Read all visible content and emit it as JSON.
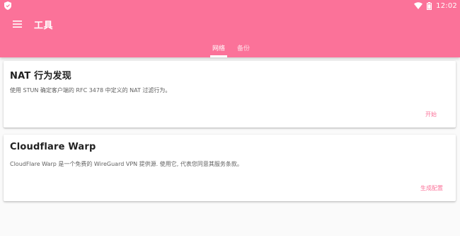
{
  "status_bar": {
    "time": "12:02",
    "icons": [
      "app-shield-icon",
      "wifi-icon",
      "battery-icon"
    ]
  },
  "toolbar": {
    "menu_icon": "menu-icon",
    "title": "工具"
  },
  "tabs": [
    {
      "label": "网络",
      "selected": true
    },
    {
      "label": "备份",
      "selected": false
    }
  ],
  "cards": [
    {
      "title": "NAT 行为发现",
      "description": "使用 STUN 确定客户端的 RFC 3478 中定义的 NAT 过滤行为。",
      "action": "开始"
    },
    {
      "title": "Cloudflare Warp",
      "description": "CloudFlare Warp 是一个免费的 WireGuard VPN 提供源. 使用它, 代表您同意其服务条款。",
      "action": "生成配置"
    }
  ],
  "colors": {
    "accent": "#fb7299",
    "background": "#fafafa",
    "card": "#ffffff",
    "text_primary": "#212121",
    "text_secondary": "#616161"
  }
}
